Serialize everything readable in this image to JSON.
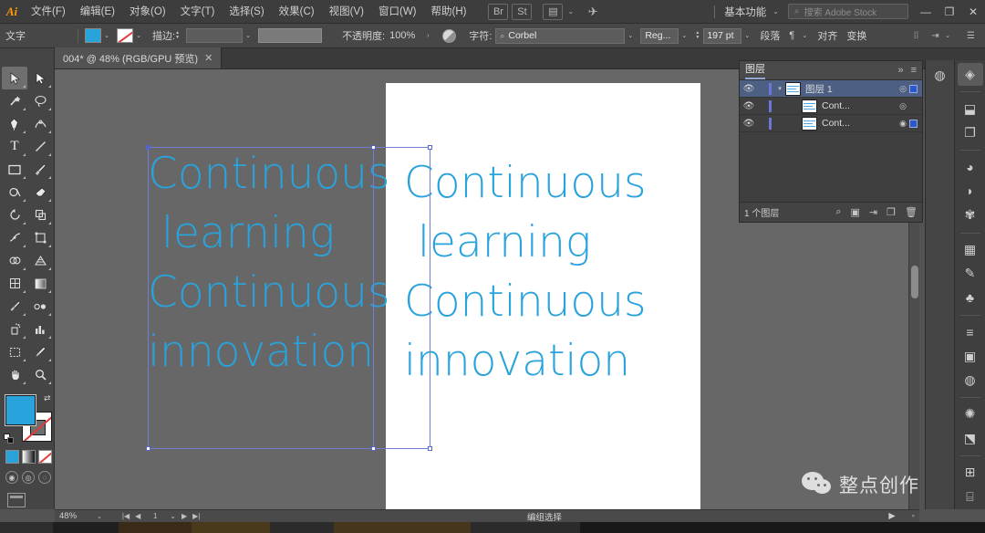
{
  "app": {
    "name": "Adobe Illustrator",
    "logo_text": "Ai"
  },
  "menubar": {
    "items": [
      {
        "label": "文件(F)"
      },
      {
        "label": "编辑(E)"
      },
      {
        "label": "对象(O)"
      },
      {
        "label": "文字(T)"
      },
      {
        "label": "选择(S)"
      },
      {
        "label": "效果(C)"
      },
      {
        "label": "视图(V)"
      },
      {
        "label": "窗口(W)"
      },
      {
        "label": "帮助(H)"
      }
    ],
    "bridge_icon": "bridge-icon",
    "stock_icon": "St",
    "arrange_icon": "arrange-documents-icon",
    "arrange_caret": "⌄",
    "rocket_icon": "discover-icon",
    "workspace": {
      "label": "基本功能",
      "caret": "⌄"
    },
    "search": {
      "icon": "search-icon",
      "placeholder": "搜索 Adobe Stock"
    },
    "window_controls": {
      "minimize": "—",
      "restore": "❐",
      "close": "✕"
    }
  },
  "optionsbar": {
    "tool_label": "文字",
    "fill_color": "#29a3dc",
    "fill_caret": "⌄",
    "stroke_caret": "⌄",
    "stroke_label": "描边:",
    "stroke_weight": "",
    "stroke_profile": "",
    "opacity_label": "不透明度:",
    "opacity_value": "100%",
    "opacity_caret": "›",
    "blend_icon": "blend-mode-icon",
    "char_label": "字符:",
    "font_search_icon": "search-icon",
    "font_name": "Corbel",
    "font_caret": "⌄",
    "font_style": "Reg...",
    "style_caret": "⌄",
    "font_size": "197 pt",
    "size_caret": "⌄",
    "paragraph_label": "段落",
    "paragraph_icon": "paragraph-icon",
    "paragraph_caret": "⌄",
    "align_label": "对齐",
    "transform_label": "变换",
    "distribute_icon": "distribute-icon",
    "indent_icon": "indent-icon",
    "indent_caret": "⌄",
    "menu_icon": "panel-menu-icon"
  },
  "doctab": {
    "title": "004* @ 48% (RGB/GPU 预览)",
    "close": "✕"
  },
  "toolbar": {
    "tools": [
      {
        "name": "selection-tool",
        "glyph": "selection",
        "selected": true
      },
      {
        "name": "direct-selection-tool",
        "glyph": "direct",
        "selected": false
      },
      {
        "name": "magic-wand-tool",
        "glyph": "wand",
        "selected": false
      },
      {
        "name": "lasso-tool",
        "glyph": "lasso",
        "selected": false
      },
      {
        "name": "pen-tool",
        "glyph": "pen",
        "selected": false
      },
      {
        "name": "curvature-tool",
        "glyph": "curvature",
        "selected": false
      },
      {
        "name": "type-tool",
        "glyph": "type",
        "selected": false
      },
      {
        "name": "line-segment-tool",
        "glyph": "line",
        "selected": false
      },
      {
        "name": "rectangle-tool",
        "glyph": "rect",
        "selected": false
      },
      {
        "name": "paintbrush-tool",
        "glyph": "brush",
        "selected": false
      },
      {
        "name": "shaper-tool",
        "glyph": "shaper",
        "selected": false
      },
      {
        "name": "eraser-tool",
        "glyph": "eraser",
        "selected": false
      },
      {
        "name": "rotate-tool",
        "glyph": "rotate",
        "selected": false
      },
      {
        "name": "scale-tool",
        "glyph": "scale",
        "selected": false
      },
      {
        "name": "width-tool",
        "glyph": "width",
        "selected": false
      },
      {
        "name": "free-transform-tool",
        "glyph": "freetrans",
        "selected": false
      },
      {
        "name": "shape-builder-tool",
        "glyph": "shapebuild",
        "selected": false
      },
      {
        "name": "perspective-grid-tool",
        "glyph": "perspect",
        "selected": false
      },
      {
        "name": "mesh-tool",
        "glyph": "mesh",
        "selected": false
      },
      {
        "name": "gradient-tool",
        "glyph": "gradient",
        "selected": false
      },
      {
        "name": "eyedropper-tool",
        "glyph": "eyedrop",
        "selected": false
      },
      {
        "name": "blend-tool",
        "glyph": "blend",
        "selected": false
      },
      {
        "name": "symbol-sprayer-tool",
        "glyph": "symbol",
        "selected": false
      },
      {
        "name": "column-graph-tool",
        "glyph": "graph",
        "selected": false
      },
      {
        "name": "artboard-tool",
        "glyph": "artboard",
        "selected": false
      },
      {
        "name": "slice-tool",
        "glyph": "slice",
        "selected": false
      },
      {
        "name": "hand-tool",
        "glyph": "hand",
        "selected": false
      },
      {
        "name": "zoom-tool",
        "glyph": "zoom",
        "selected": false
      }
    ],
    "fill_color": "#29a3dc",
    "stroke_color": "none",
    "swap_icon": "swap-fill-stroke-icon",
    "default_icon": "default-fill-stroke-icon",
    "modes": [
      {
        "name": "color-mode-button",
        "kind": "c"
      },
      {
        "name": "gradient-mode-button",
        "kind": "g"
      },
      {
        "name": "none-mode-button",
        "kind": "n"
      }
    ],
    "draw_modes": [
      {
        "name": "draw-normal-button",
        "glyph": "◉"
      },
      {
        "name": "draw-behind-button",
        "glyph": "◎"
      },
      {
        "name": "draw-inside-button",
        "glyph": "◌"
      }
    ],
    "screen_mode": "change-screen-mode-button"
  },
  "canvas": {
    "artboard_text": "Continuous\n learning\nContinuous\ninnovation",
    "selected_text": "Continuous\n learning\nContinuous\ninnovation",
    "text_color": "#29a3dc",
    "selection_color": "#6f7fd4"
  },
  "layers_panel": {
    "title": "图层",
    "collapse_icon": "»",
    "menu_icon": "≡",
    "rows": [
      {
        "name": "图层 1",
        "selected": true,
        "visible": true,
        "locked": false,
        "has_target": true,
        "sel_square": true,
        "indent": 0
      },
      {
        "name": "Cont...",
        "selected": false,
        "visible": true,
        "locked": false,
        "has_target": true,
        "sel_square": false,
        "indent": 1
      },
      {
        "name": "Cont...",
        "selected": false,
        "visible": true,
        "locked": false,
        "has_target": true,
        "sel_square": true,
        "indent": 1
      }
    ],
    "footer_count": "1 个图层",
    "footer_icons": [
      {
        "name": "locate-object-button",
        "glyph": "⌕"
      },
      {
        "name": "make-clipping-mask-button",
        "glyph": "▣"
      },
      {
        "name": "create-new-sublayer-button",
        "glyph": "⇥"
      },
      {
        "name": "create-new-layer-button",
        "glyph": "❐"
      },
      {
        "name": "delete-selection-button",
        "glyph": "🗑"
      }
    ]
  },
  "dock": {
    "column_a": [
      {
        "name": "panel-layers-icon",
        "glyph": "◈",
        "active": true
      },
      {
        "name": "panel-artboards-icon",
        "glyph": "⬓",
        "active": false
      },
      {
        "name": "panel-asset-export-icon",
        "glyph": "❐",
        "active": false
      },
      {
        "name": "panel-color-icon",
        "glyph": "🎨",
        "active": false
      },
      {
        "name": "panel-color-guide-icon",
        "glyph": "◗",
        "active": false
      },
      {
        "name": "panel-swatches-icon",
        "glyph": "⚙",
        "active": false
      },
      {
        "name": "panel-brushes-icon",
        "glyph": "▦",
        "active": false
      },
      {
        "name": "panel-symbols-icon",
        "glyph": "✎",
        "active": false
      },
      {
        "name": "panel-stroke-icon",
        "glyph": "♣",
        "active": false
      },
      {
        "name": "panel-gradient-icon",
        "glyph": "≡",
        "active": false
      },
      {
        "name": "panel-transparency-icon",
        "glyph": "▣",
        "active": false
      },
      {
        "name": "panel-appearance-icon",
        "glyph": "◍",
        "active": false
      },
      {
        "name": "panel-graphic-styles-icon",
        "glyph": "✺",
        "active": false
      },
      {
        "name": "panel-pathfinder-icon",
        "glyph": "⬔",
        "active": false
      },
      {
        "name": "panel-align-icon",
        "glyph": "⊞",
        "active": false
      },
      {
        "name": "panel-transform-icon",
        "glyph": "⌸",
        "active": false
      },
      {
        "name": "panel-libraries-icon",
        "glyph": "☁",
        "active": false
      }
    ],
    "column_b": [
      {
        "name": "panel-cc-libraries-icon",
        "glyph": "◍",
        "active": false
      }
    ]
  },
  "statusbar": {
    "zoom": "48%",
    "zoom_caret": "⌄",
    "nav_first": "|◀",
    "nav_prev": "◀",
    "page": "1",
    "page_caret": "⌄",
    "nav_next": "▶",
    "nav_last": "▶|",
    "tool_text": "编组选择",
    "play": "▶",
    "more": "◦"
  },
  "watermark": {
    "text": "整点创作",
    "icon": "wechat-icon"
  }
}
